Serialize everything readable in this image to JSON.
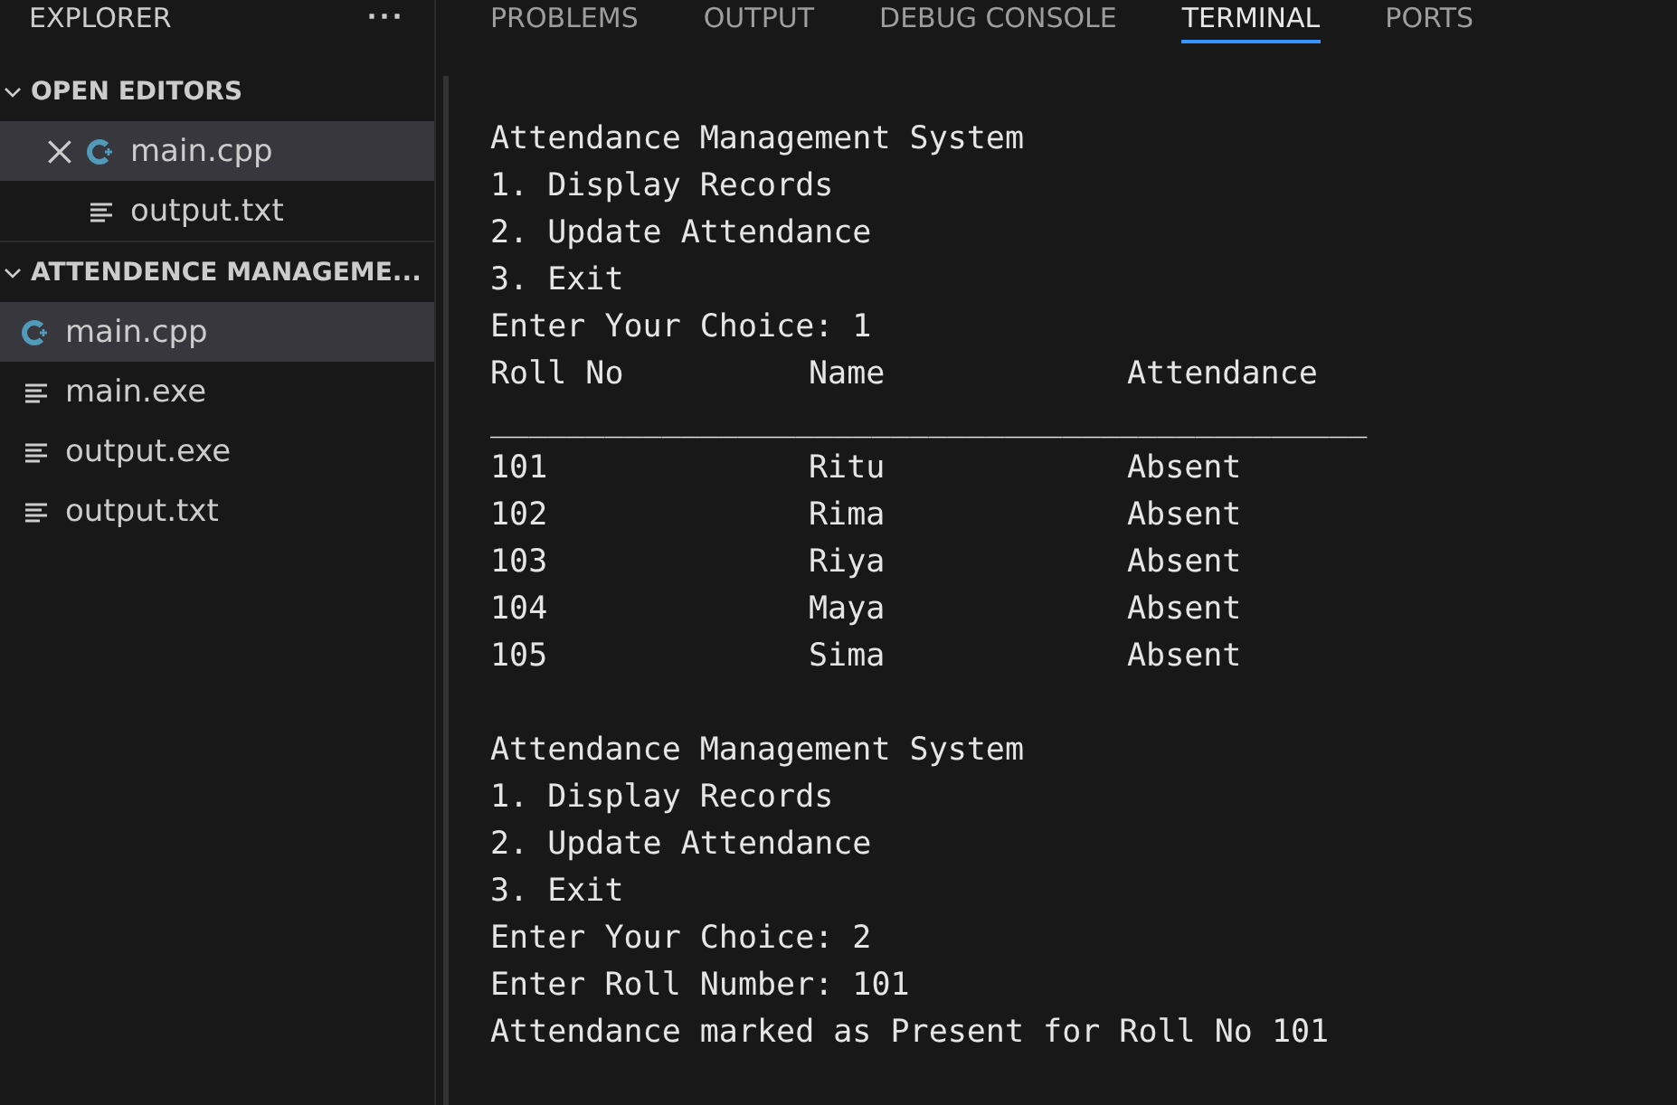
{
  "sidebar": {
    "title": "EXPLORER",
    "more": "···",
    "sections": [
      {
        "label": "OPEN EDITORS",
        "expanded": true,
        "items": [
          {
            "name": "main.cpp",
            "kind": "cpp",
            "selected": true,
            "closable": true
          },
          {
            "name": "output.txt",
            "kind": "text",
            "selected": false,
            "closable": false
          }
        ]
      },
      {
        "label": "ATTENDENCE MANAGEME...",
        "expanded": true,
        "items": [
          {
            "name": "main.cpp",
            "kind": "cpp",
            "selected": true,
            "closable": false
          },
          {
            "name": "main.exe",
            "kind": "text",
            "selected": false,
            "closable": false
          },
          {
            "name": "output.exe",
            "kind": "text",
            "selected": false,
            "closable": false
          },
          {
            "name": "output.txt",
            "kind": "text",
            "selected": false,
            "closable": false
          }
        ]
      }
    ]
  },
  "panel": {
    "tabs": [
      {
        "label": "PROBLEMS",
        "selected": false
      },
      {
        "label": "OUTPUT",
        "selected": false
      },
      {
        "label": "DEBUG CONSOLE",
        "selected": false
      },
      {
        "label": "TERMINAL",
        "selected": true
      },
      {
        "label": "PORTS",
        "selected": false
      }
    ],
    "terminal": [
      {
        "kind": "text",
        "text": "Attendance Management System"
      },
      {
        "kind": "text",
        "text": "1. Display Records"
      },
      {
        "kind": "text",
        "text": "2. Update Attendance"
      },
      {
        "kind": "text",
        "text": "3. Exit"
      },
      {
        "kind": "text",
        "text": "Enter Your Choice: 1"
      },
      {
        "kind": "row",
        "cells": [
          "Roll No",
          "Name",
          "Attendance"
        ]
      },
      {
        "kind": "text",
        "text": "______________________________________________"
      },
      {
        "kind": "row",
        "cells": [
          "101",
          "Ritu",
          "Absent"
        ]
      },
      {
        "kind": "row",
        "cells": [
          "102",
          "Rima",
          "Absent"
        ]
      },
      {
        "kind": "row",
        "cells": [
          "103",
          "Riya",
          "Absent"
        ]
      },
      {
        "kind": "row",
        "cells": [
          "104",
          "Maya",
          "Absent"
        ]
      },
      {
        "kind": "row",
        "cells": [
          "105",
          "Sima",
          "Absent"
        ]
      },
      {
        "kind": "blank"
      },
      {
        "kind": "text",
        "text": "Attendance Management System"
      },
      {
        "kind": "text",
        "text": "1. Display Records"
      },
      {
        "kind": "text",
        "text": "2. Update Attendance"
      },
      {
        "kind": "text",
        "text": "3. Exit"
      },
      {
        "kind": "text",
        "text": "Enter Your Choice: 2"
      },
      {
        "kind": "text",
        "text": "Enter Roll Number: 101"
      },
      {
        "kind": "text",
        "text": "Attendance marked as Present for Roll No 101"
      }
    ]
  }
}
